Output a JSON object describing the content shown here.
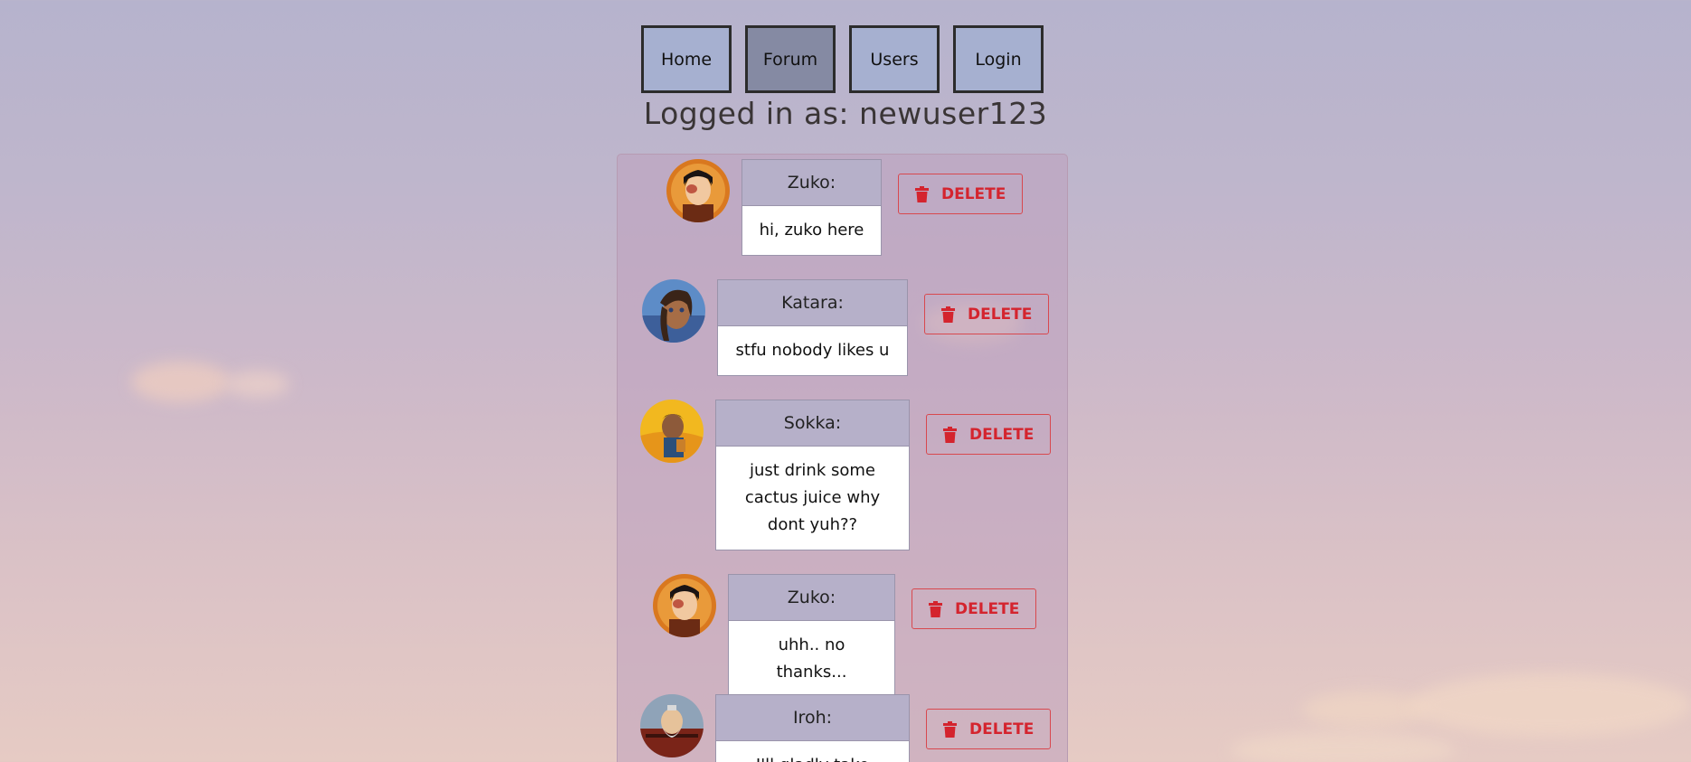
{
  "nav": {
    "items": [
      {
        "label": "Home",
        "active": false
      },
      {
        "label": "Forum",
        "active": true
      },
      {
        "label": "Users",
        "active": false
      },
      {
        "label": "Login",
        "active": false
      }
    ]
  },
  "status": {
    "logged_in_text": "Logged in as: newuser123"
  },
  "posts": [
    {
      "author": "Zuko:",
      "message": "hi, zuko here",
      "delete_label": "DELETE",
      "avatar": "zuko-avatar"
    },
    {
      "author": "Katara:",
      "message": "stfu nobody likes u",
      "delete_label": "DELETE",
      "avatar": "katara-avatar"
    },
    {
      "author": "Sokka:",
      "message": "just drink some cactus juice why dont yuh??",
      "delete_label": "DELETE",
      "avatar": "sokka-avatar"
    },
    {
      "author": "Zuko:",
      "message": "uhh.. no thanks...",
      "delete_label": "DELETE",
      "avatar": "zuko-avatar"
    },
    {
      "author": "Iroh:",
      "message": "I'll gladly take",
      "delete_label": "DELETE",
      "avatar": "iroh-avatar"
    }
  ],
  "colors": {
    "nav_bg": "#a6b0d0",
    "nav_active_bg": "#858aa3",
    "delete_red": "#d4242e",
    "card_header": "#b6b0c9"
  },
  "icons": {
    "delete": "trash-icon"
  }
}
